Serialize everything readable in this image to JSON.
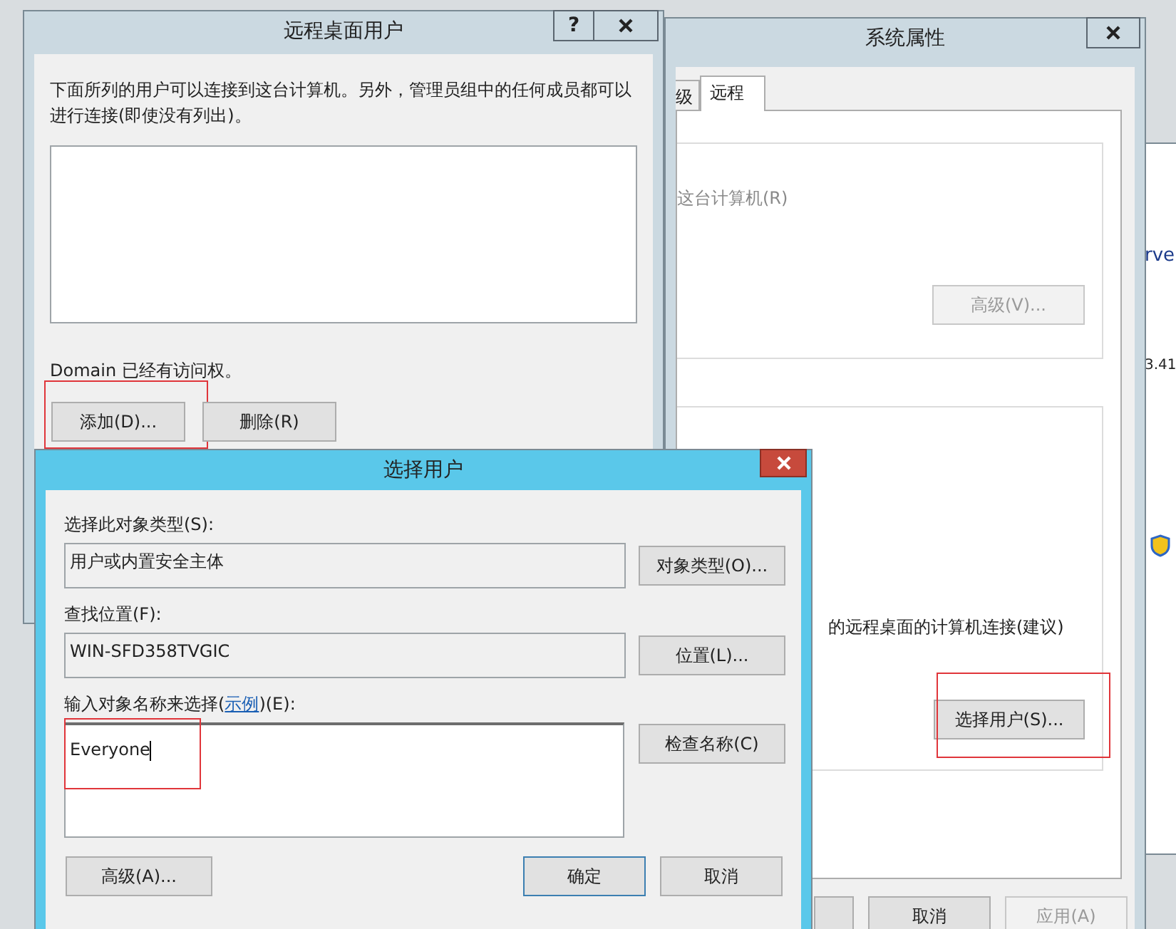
{
  "background_window": {
    "texts": [
      "rve",
      "3.41"
    ]
  },
  "system_properties": {
    "title": "系统属性",
    "tabs": [
      {
        "label": "级",
        "selected": false
      },
      {
        "label": "远程",
        "selected": true
      }
    ],
    "remote_assistance": {
      "label": "这台计算机(R)",
      "disabled": true,
      "advanced_button": {
        "label": "高级(V)...",
        "disabled": true
      }
    },
    "remote_desktop": {
      "option_label": "的远程桌面的计算机连接(建议)",
      "select_users_button": {
        "label": "选择用户(S)...",
        "highlighted": true
      }
    },
    "buttons": [
      {
        "label": "取消",
        "disabled": false
      },
      {
        "label": "应用(A)",
        "disabled": true
      }
    ]
  },
  "remote_desktop_users": {
    "title": "远程桌面用户",
    "help_button": "?",
    "description": "下面所列的用户可以连接到这台计算机。另外，管理员组中的任何成员都可以进行连接(即使没有列出)。",
    "status": "Domain 已经有访问权。",
    "buttons": [
      {
        "label": "添加(D)...",
        "highlighted": true
      },
      {
        "label": "删除(R)",
        "highlighted": false
      }
    ]
  },
  "select_users": {
    "title": "选择用户",
    "fields": [
      {
        "label": "选择此对象类型(S):",
        "value": "用户或内置安全主体",
        "button": "对象类型(O)..."
      },
      {
        "label": "查找位置(F):",
        "value": "WIN-SFD358TVGIC",
        "button": "位置(L)..."
      }
    ],
    "names": {
      "label_before": "输入对象名称来选择(",
      "link": "示例",
      "label_after": ")(E):",
      "value": "Everyone",
      "highlighted": true,
      "button": "检查名称(C)"
    },
    "advanced_button": "高级(A)...",
    "buttons": [
      {
        "label": "确定",
        "default": true
      },
      {
        "label": "取消",
        "default": false
      }
    ]
  }
}
